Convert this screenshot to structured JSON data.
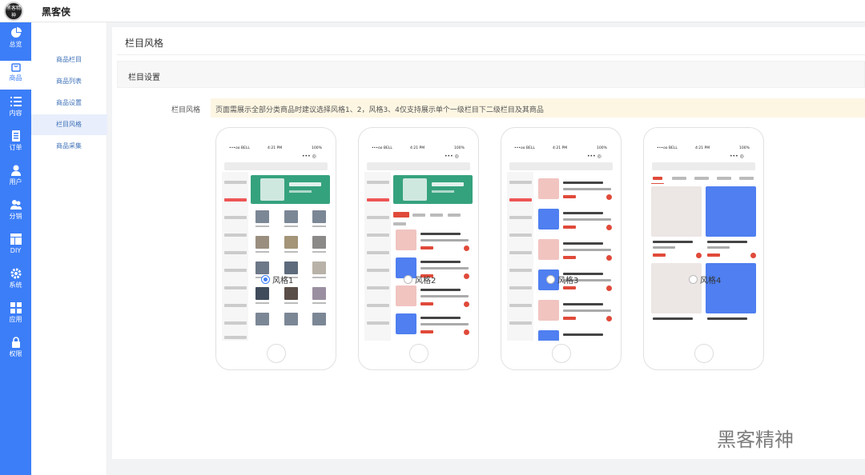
{
  "app": {
    "logo_text": "黑客精神",
    "name": "黑客侠"
  },
  "sidebar": {
    "items": [
      {
        "label": "总览",
        "icon": "pie-chart-icon"
      },
      {
        "label": "商品",
        "icon": "shopping-bag-icon"
      },
      {
        "label": "内容",
        "icon": "list-icon"
      },
      {
        "label": "订单",
        "icon": "document-icon"
      },
      {
        "label": "用户",
        "icon": "user-icon"
      },
      {
        "label": "分销",
        "icon": "users-icon"
      },
      {
        "label": "DIY",
        "icon": "layout-icon"
      },
      {
        "label": "系统",
        "icon": "gear-icon"
      },
      {
        "label": "应用",
        "icon": "grid-icon"
      },
      {
        "label": "权限",
        "icon": "lock-icon"
      }
    ]
  },
  "subnav": {
    "items": [
      {
        "label": "商品栏目"
      },
      {
        "label": "商品列表"
      },
      {
        "label": "商品设置"
      },
      {
        "label": "栏目风格"
      },
      {
        "label": "商品采集"
      }
    ]
  },
  "page": {
    "title": "栏目风格",
    "section_title": "栏目设置",
    "field_label": "栏目风格",
    "notice": "页面需展示全部分类商品时建议选择风格1、2，风格3、4仅支持展示单个一级栏目下二级栏目及其商品"
  },
  "phone": {
    "carrier": "•••oo BELL",
    "time": "4:21 PM",
    "battery": "100%"
  },
  "styles": [
    {
      "label": "风格1",
      "selected": true
    },
    {
      "label": "风格2",
      "selected": false
    },
    {
      "label": "风格3",
      "selected": false
    },
    {
      "label": "风格4",
      "selected": false
    }
  ],
  "watermark": "黑客精神",
  "colors": {
    "accent": "#3c7ef8",
    "price_red": "#e04a3a",
    "notice_bg": "#fdf6e3"
  }
}
